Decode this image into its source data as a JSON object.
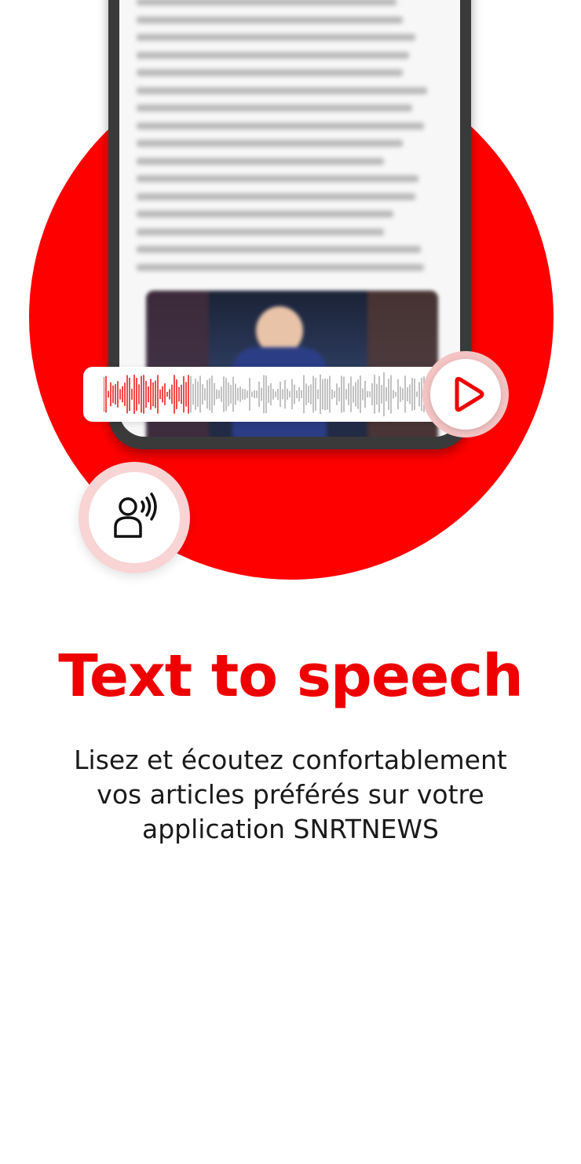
{
  "hero": {
    "accent_color": "#ff0000",
    "article_preview": "blurred article text and basketball photo",
    "audio_player": {
      "play_icon": "play-icon",
      "waveform_icon": "audio-waveform"
    },
    "speaker_icon": "voice-speaker-icon"
  },
  "content": {
    "title": "Text to speech",
    "description_lines": [
      "Lisez et écoutez confortablement",
      "vos articles préférés sur votre",
      "application SNRTNEWS"
    ]
  }
}
